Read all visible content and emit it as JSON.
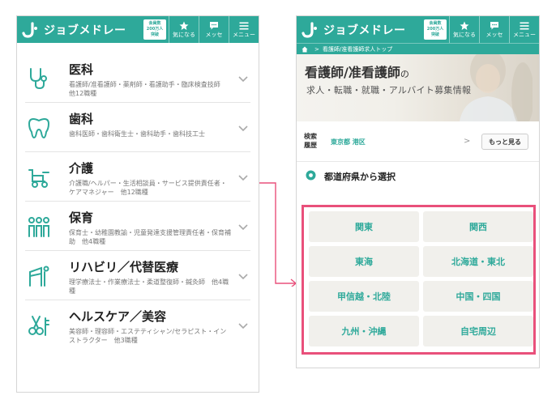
{
  "header": {
    "logo_text": "ジョブメドレー",
    "members_line1": "会員数",
    "members_line2": "200万人",
    "members_line3": "突破",
    "favorite_label": "気になる",
    "message_label": "メッセ",
    "menu_label": "メニュー"
  },
  "categories": [
    {
      "name": "医科",
      "desc": "看護師/准看護師・薬剤師・看護助手・臨床検査技師　他12職種",
      "icon": "stethoscope-icon"
    },
    {
      "name": "歯科",
      "desc": "歯科医師・歯科衛生士・歯科助手・歯科技工士",
      "icon": "tooth-icon"
    },
    {
      "name": "介護",
      "desc": "介護職/ヘルパー・生活相談員・サービス提供責任者・ケアマネジャー　他12職種",
      "icon": "wheelchair-icon"
    },
    {
      "name": "保育",
      "desc": "保育士・幼稚園教諭・児童発達支援管理責任者・保育補助　他4職種",
      "icon": "children-icon"
    },
    {
      "name": "リハビリ／代替医療",
      "desc": "理学療法士・作業療法士・柔道整復師・鍼灸師　他4職種",
      "icon": "rehab-icon"
    },
    {
      "name": "ヘルスケア／美容",
      "desc": "美容師・理容師・エステティシャン/セラピスト・インストラクター　他3職種",
      "icon": "scissors-icon"
    }
  ],
  "breadcrumb": {
    "separator": ">",
    "current": "看護師/准看護師求人トップ"
  },
  "hero": {
    "title": "看護師/准看護師",
    "title_suffix": "の",
    "subtitle": "求人・転職・就職・アルバイト募集情報"
  },
  "search_history": {
    "label_line1": "検索",
    "label_line2": "履歴",
    "value": "東京都 港区",
    "chevron": ">",
    "more_label": "もっと見る"
  },
  "prefecture": {
    "title": "都道府県から選択",
    "regions": [
      "関東",
      "関西",
      "東海",
      "北海道・東北",
      "甲信越・北陸",
      "中国・四国",
      "九州・沖縄",
      "自宅周辺"
    ]
  },
  "colors": {
    "brand": "#2ea99a",
    "highlight": "#e9507b",
    "region_bg": "#f1f0ec"
  }
}
